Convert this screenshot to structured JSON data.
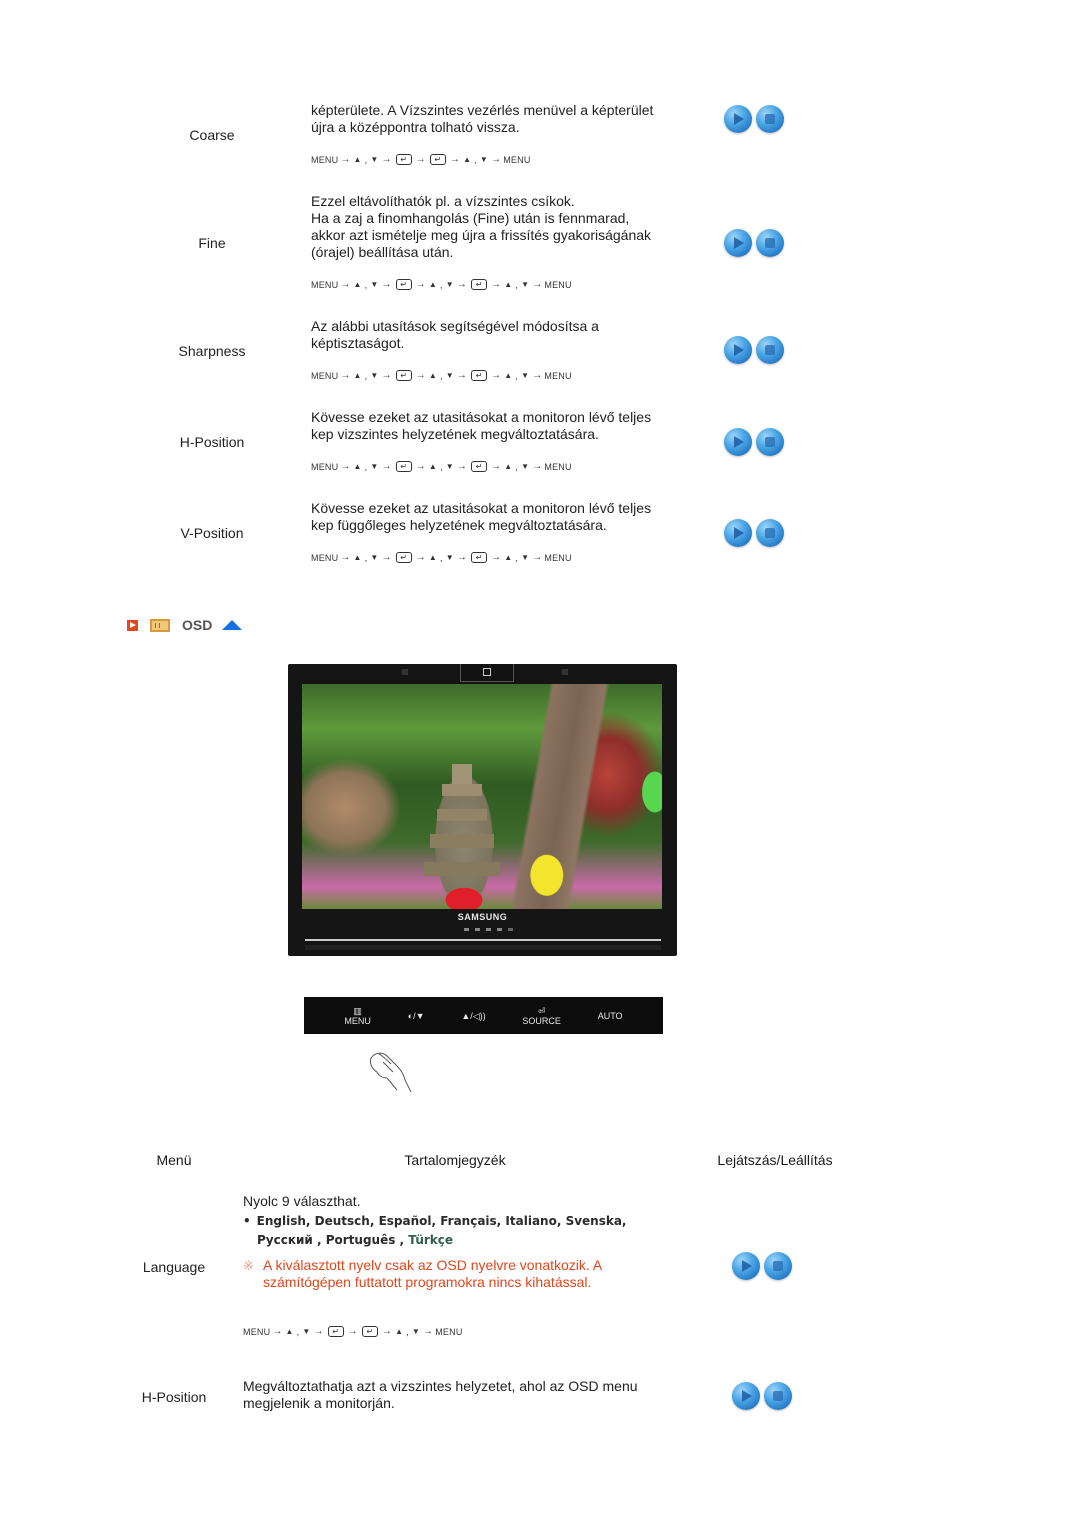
{
  "controls_section": {
    "rows": [
      {
        "label": "Coarse",
        "description": [
          "képterülete. A Vízszintes vezérlés menüvel a képterület",
          "újra a középpontra tolható vissza."
        ],
        "sequence": [
          "MENU",
          "→",
          "▲",
          ",",
          "▼",
          "→",
          "enter",
          "→",
          "enter",
          "→",
          "▲",
          ",",
          "▼",
          "→",
          "MENU"
        ]
      },
      {
        "label": "Fine",
        "description": [
          "Ezzel eltávolíthatók pl. a vízszintes csíkok.",
          "Ha a zaj a finomhangolás (Fine) után is fennmarad,",
          "akkor azt ismételje meg újra a frissítés gyakoriságának",
          "(órajel) beállítása után."
        ],
        "sequence": [
          "MENU",
          "→",
          "▲",
          ",",
          "▼",
          "→",
          "enter",
          "→",
          "▲",
          ",",
          "▼",
          "→",
          "enter",
          "→",
          "▲",
          ",",
          "▼",
          "→",
          "MENU"
        ]
      },
      {
        "label": "Sharpness",
        "description": [
          "Az alábbi utasítások segítségével módosítsa a",
          "képtisztaságot."
        ],
        "sequence": [
          "MENU",
          "→",
          "▲",
          ",",
          "▼",
          "→",
          "enter",
          "→",
          "▲",
          ",",
          "▼",
          "→",
          "enter",
          "→",
          "▲",
          ",",
          "▼",
          "→",
          "MENU"
        ]
      },
      {
        "label": "H-Position",
        "description": [
          "Kövesse ezeket az utasitásokat a monitoron lévő teljes",
          "kep vizszintes helyzetének megváltoztatására."
        ],
        "sequence": [
          "MENU",
          "→",
          "▲",
          ",",
          "▼",
          "→",
          "enter",
          "→",
          "▲",
          ",",
          "▼",
          "→",
          "enter",
          "→",
          "▲",
          ",",
          "▼",
          "→",
          "MENU"
        ]
      },
      {
        "label": "V-Position",
        "description": [
          "Kövesse ezeket az utasitásokat a monitoron lévő teljes",
          "kep függőleges helyzetének megváltoztatására."
        ],
        "sequence": [
          "MENU",
          "→",
          "▲",
          ",",
          "▼",
          "→",
          "enter",
          "→",
          "▲",
          ",",
          "▼",
          "→",
          "enter",
          "→",
          "▲",
          ",",
          "▼",
          "→",
          "MENU"
        ]
      }
    ]
  },
  "osd_heading": {
    "title": "OSD",
    "icons": [
      "play-icon",
      "osd-icon",
      "up-arrow-icon"
    ]
  },
  "monitor": {
    "brand": "SAMSUNG",
    "front_buttons": [
      "MENU",
      "◐/▼",
      "▲/◁))",
      "SOURCE",
      "AUTO"
    ]
  },
  "table_header": {
    "col1": "Menü",
    "col2": "Tartalomjegyzék",
    "col3": "Lejátszás/Leállítás"
  },
  "osd_rows": {
    "language": {
      "label": "Language",
      "intro": "Nyolc 9 választhat.",
      "languages_line1": "English, Deutsch, Español, Français,  Italiano, Svenska,",
      "languages_line2a": "Русский , Português , ",
      "languages_line2b": "Türkçe",
      "note_symbol": "※",
      "note": [
        "A kiválasztott nyelv csak az OSD nyelvre vonatkozik. A",
        "számítógépen futtatott programokra nincs kihatással."
      ],
      "sequence": [
        "MENU",
        "→",
        "▲",
        ",",
        "▼",
        "→",
        "enter",
        "→",
        "enter",
        "→",
        "▲",
        ",",
        "▼",
        "→",
        "MENU"
      ]
    },
    "h_position": {
      "label": "H-Position",
      "description": [
        "Megváltoztathatja azt a vizszintes helyzetet, ahol az OSD menu",
        "megjelenik a monitorján."
      ]
    }
  },
  "colors": {
    "note": "#e0461c",
    "accent_blue": "#1a6fe0",
    "button_blue": "#3a8fd6"
  }
}
